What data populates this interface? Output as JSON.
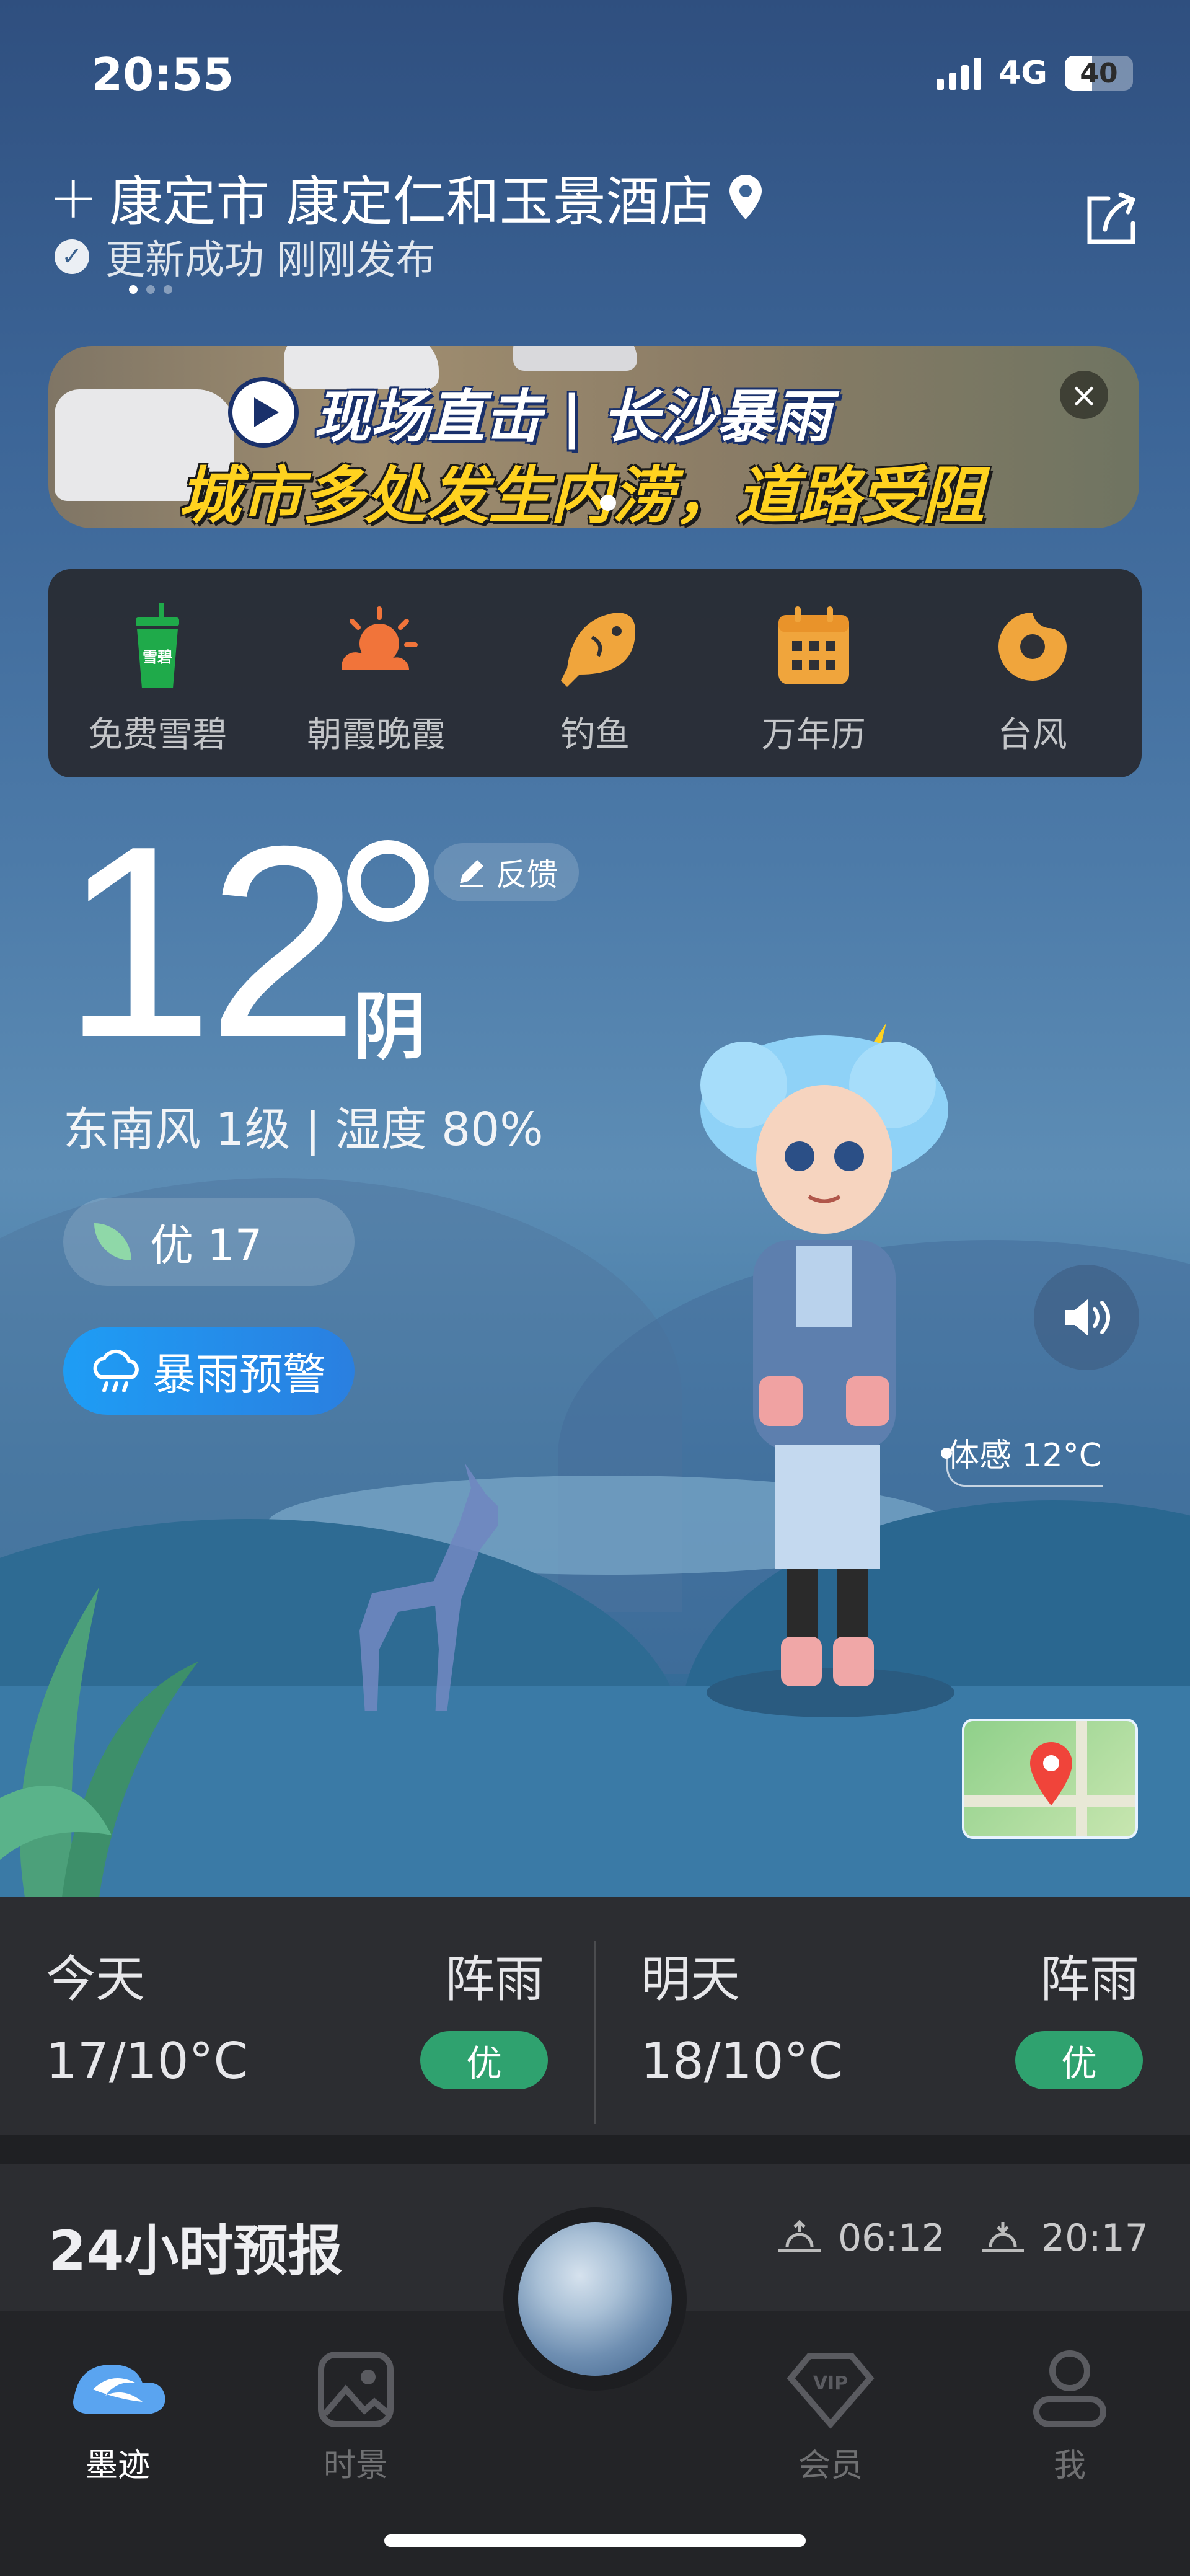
{
  "status_bar": {
    "time": "20:55",
    "network": "4G",
    "battery": "40",
    "battery_level": 0.4
  },
  "header": {
    "add_symbol": "+",
    "location": "康定市 康定仁和玉景酒店",
    "update_text": "更新成功 刚刚发布"
  },
  "banner": {
    "title": "现场直击 | 长沙暴雨",
    "subtitle": "城市多处发生内涝，道路受阻",
    "close": "×"
  },
  "shortcuts": [
    {
      "label": "免费雪碧",
      "icon": "sprite-cup-icon"
    },
    {
      "label": "朝霞晚霞",
      "icon": "sunrise-cloud-icon"
    },
    {
      "label": "钓鱼",
      "icon": "fish-icon"
    },
    {
      "label": "万年历",
      "icon": "calendar-icon"
    },
    {
      "label": "台风",
      "icon": "typhoon-icon"
    }
  ],
  "current": {
    "temp": "12",
    "condition": "阴",
    "feedback": "反馈",
    "wind_humidity": "东南风 1级 | 湿度 80%",
    "aqi": "优 17",
    "warning": "暴雨预警",
    "feels_like": "体感 12°C"
  },
  "daily": [
    {
      "day": "今天",
      "condition": "阵雨",
      "temp": "17/10°C",
      "aqi": "优"
    },
    {
      "day": "明天",
      "condition": "阵雨",
      "temp": "18/10°C",
      "aqi": "优"
    }
  ],
  "forecast": {
    "title": "24小时预报",
    "sunrise": "06:12",
    "sunset": "20:17"
  },
  "nav": [
    {
      "label": "墨迹",
      "icon": "moji-logo-icon",
      "active": true
    },
    {
      "label": "时景",
      "icon": "image-icon",
      "active": false
    },
    {
      "label": "会员",
      "icon": "vip-diamond-icon",
      "active": false
    },
    {
      "label": "我",
      "icon": "profile-icon",
      "active": false
    }
  ],
  "colors": {
    "accent_blue": "#1e9df5",
    "aqi_green": "#2fa26f",
    "banner_yellow": "#ffd21f"
  }
}
